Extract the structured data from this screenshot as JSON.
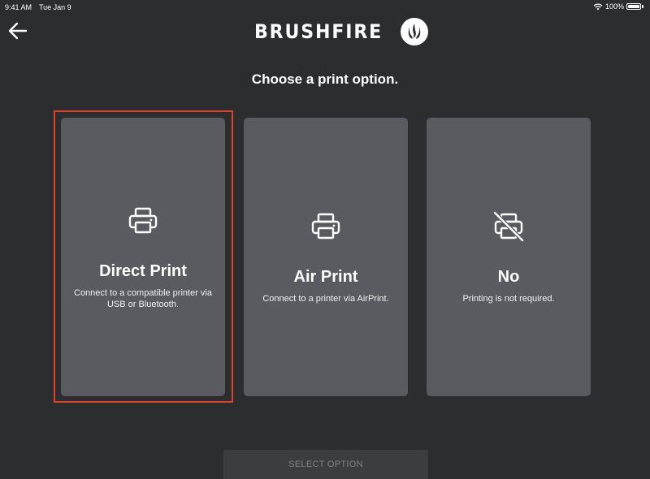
{
  "status_bar": {
    "time": "9:41 AM",
    "date": "Tue Jan 9",
    "battery_percent": "100%",
    "wifi_icon": "wifi-icon",
    "battery_icon": "battery-icon"
  },
  "header": {
    "back_icon": "arrow-left-icon",
    "logo_text": "BRUSHFIRE",
    "logo_icon": "flame-icon"
  },
  "page_title": "Choose a print option.",
  "options": [
    {
      "title": "Direct Print",
      "description": "Connect to a compatible printer via USB or Bluetooth.",
      "icon": "printer-icon",
      "selected": true
    },
    {
      "title": "Air Print",
      "description": "Connect to a printer via AirPrint.",
      "icon": "printer-icon",
      "selected": false
    },
    {
      "title": "No",
      "description": "Printing is not required.",
      "icon": "printer-off-icon",
      "selected": false
    }
  ],
  "select_button": {
    "label": "SELECT OPTION"
  },
  "colors": {
    "background": "#2c2d2f",
    "card": "#595b60",
    "selected_outline": "#e0402c",
    "disabled_text": "#808287"
  }
}
